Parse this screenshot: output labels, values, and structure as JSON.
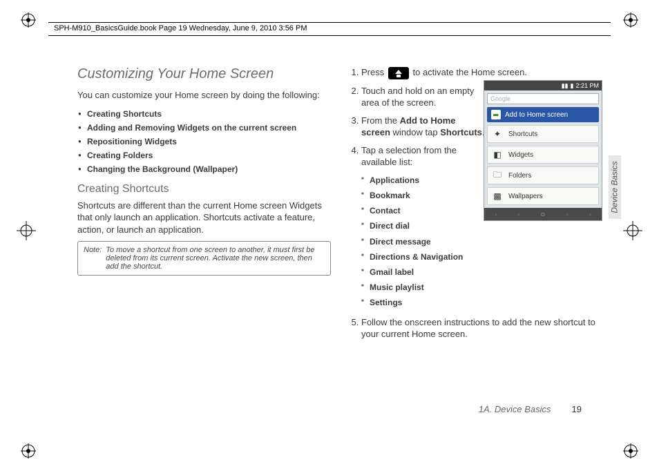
{
  "header": {
    "book_line": "SPH-M910_BasicsGuide.book  Page 19  Wednesday, June 9, 2010  3:56 PM"
  },
  "left": {
    "title": "Customizing Your Home Screen",
    "intro": "You can customize your Home screen by doing the following:",
    "bullets": [
      "Creating Shortcuts",
      "Adding and Removing Widgets on the current screen",
      "Repositioning Widgets",
      "Creating Folders",
      "Changing the Background (Wallpaper)"
    ],
    "sub_title": "Creating Shortcuts",
    "sub_body": "Shortcuts are different than the current Home screen Widgets that only launch an application. Shortcuts activate a feature, action, or launch an application.",
    "note_label": "Note:",
    "note_text": "To move a shortcut from one screen to another, it must first be deleted from its current screen. Activate the new screen, then add the shortcut."
  },
  "right": {
    "step1_a": "Press",
    "step1_b": "to activate the Home screen.",
    "step2": "Touch and hold on an empty area of the screen.",
    "step3_a": "From the",
    "step3_bold1": "Add to Home screen",
    "step3_b": "window tap",
    "step3_bold2": "Shortcuts",
    "step3_c": ".",
    "step4": "Tap a selection from the available list:",
    "sublist": [
      "Applications",
      "Bookmark",
      "Contact",
      "Direct dial",
      "Direct message",
      "Directions & Navigation",
      "Gmail label",
      "Music playlist",
      "Settings"
    ],
    "step5": "Follow the onscreen instructions to add the new shortcut to your current Home screen."
  },
  "phone": {
    "time": "2:21 PM",
    "search_placeholder": "Google",
    "menu_title": "Add to Home screen",
    "rows": [
      "Shortcuts",
      "Widgets",
      "Folders",
      "Wallpapers"
    ]
  },
  "side_tab": "Device Basics",
  "footer": {
    "section": "1A. Device Basics",
    "page": "19"
  }
}
